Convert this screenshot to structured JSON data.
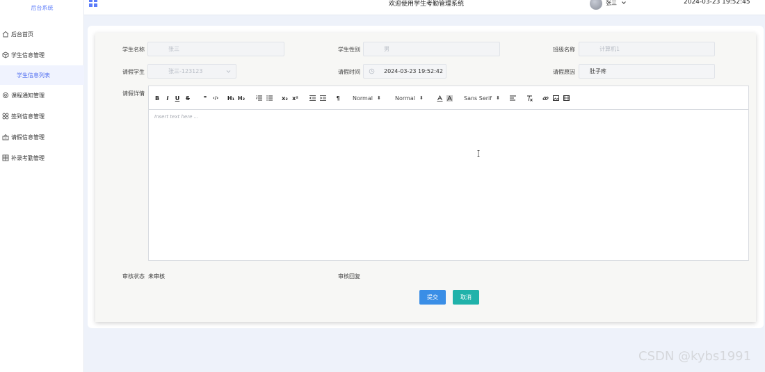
{
  "app": {
    "title": "后台系统"
  },
  "sidebar": {
    "items": [
      {
        "label": "后台首页",
        "icon": "home-icon"
      },
      {
        "label": "学生信息管理",
        "icon": "cube-icon"
      },
      {
        "label": "学生信息列表",
        "icon": ""
      },
      {
        "label": "课程通知管理",
        "icon": "gear-icon"
      },
      {
        "label": "签到信息管理",
        "icon": "grid-icon"
      },
      {
        "label": "请假信息管理",
        "icon": "tray-icon"
      },
      {
        "label": "补录考勤管理",
        "icon": "table-icon"
      }
    ]
  },
  "header": {
    "welcome": "欢迎使用学生考勤管理系统",
    "username": "张三",
    "datetime": "2024-03-23 19:52:45"
  },
  "form": {
    "student_name": {
      "label": "学生名称",
      "value": "张三"
    },
    "student_gender": {
      "label": "学生性别",
      "value": "男"
    },
    "class_name": {
      "label": "班级名称",
      "value": "计算机1"
    },
    "leave_student": {
      "label": "请假学生",
      "value": "张三-123123"
    },
    "leave_time": {
      "label": "请假时间",
      "value": "2024-03-23 19:52:42"
    },
    "leave_reason": {
      "label": "请假原因",
      "value": "肚子疼"
    },
    "leave_detail": {
      "label": "请假详情",
      "placeholder": "Insert text here ..."
    },
    "review_status": {
      "label": "审核状态",
      "value": "未审核"
    },
    "review_reply": {
      "label": "审核回复"
    }
  },
  "toolbar": {
    "header_select": "Normal",
    "size_select": "Normal",
    "font_select": "Sans Serif",
    "buttons": [
      "B",
      "I",
      "U",
      "S",
      "❞",
      "‹/›",
      "H₁",
      "H₂",
      "x₂",
      "x²",
      "¶"
    ]
  },
  "actions": {
    "submit": "提交",
    "cancel": "取消"
  },
  "colors": {
    "accent": "#5c7cfa",
    "submit": "#3a8ee6",
    "cancel": "#20b2aa"
  },
  "watermark": "CSDN @kybs1991"
}
